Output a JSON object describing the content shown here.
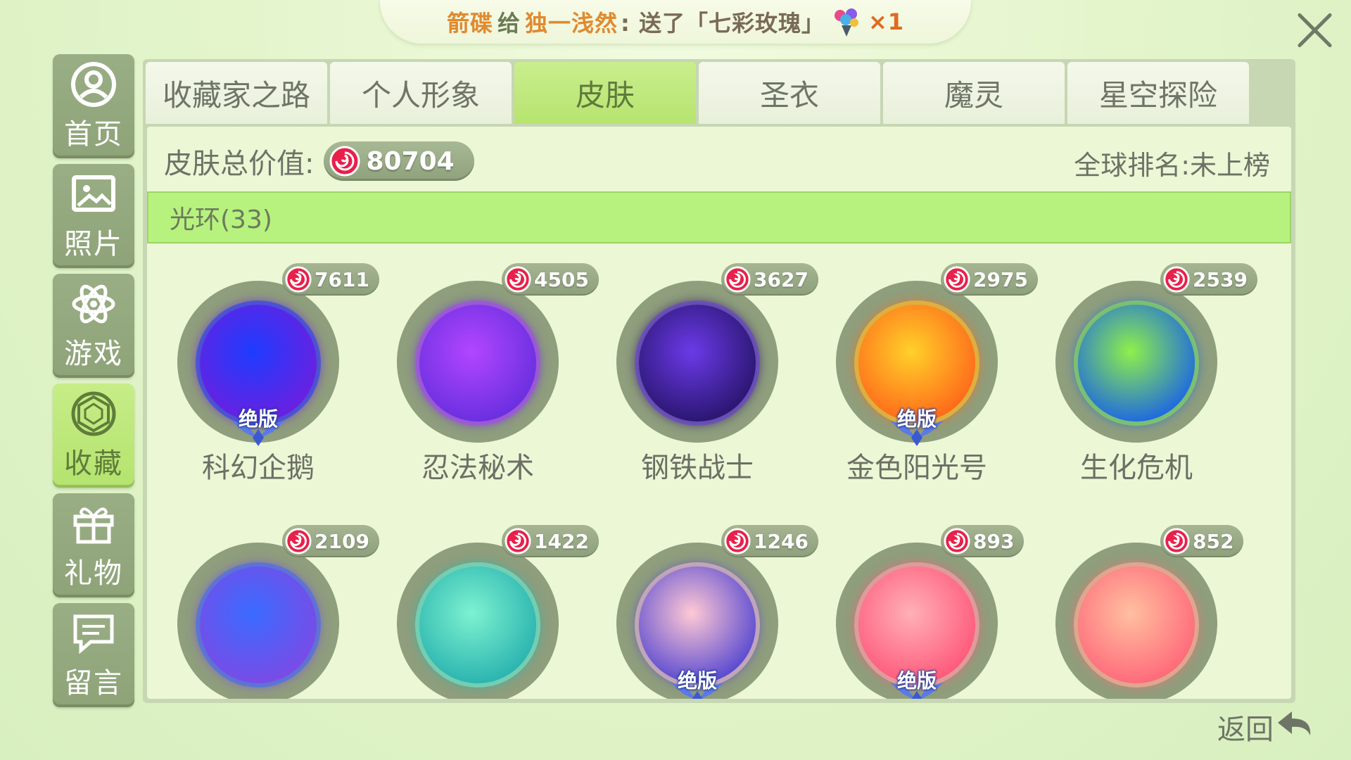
{
  "banner": {
    "sender": "箭碟",
    "gift_word": "给",
    "receiver": "独一浅然",
    "message": ": 送了「七彩玫瑰」",
    "count": "×1"
  },
  "sidebar": {
    "items": [
      {
        "label": "首页",
        "icon": "user-circle-icon",
        "active": false
      },
      {
        "label": "照片",
        "icon": "picture-icon",
        "active": false
      },
      {
        "label": "游戏",
        "icon": "atom-icon",
        "active": false
      },
      {
        "label": "收藏",
        "icon": "gem-icon",
        "active": true
      },
      {
        "label": "礼物",
        "icon": "gift-icon",
        "active": false
      },
      {
        "label": "留言",
        "icon": "message-icon",
        "active": false
      }
    ]
  },
  "tabs": [
    {
      "label": "收藏家之路",
      "active": false
    },
    {
      "label": "个人形象",
      "active": false
    },
    {
      "label": "皮肤",
      "active": true
    },
    {
      "label": "圣衣",
      "active": false
    },
    {
      "label": "魔灵",
      "active": false
    },
    {
      "label": "星空探险",
      "active": false
    }
  ],
  "summary": {
    "total_label": "皮肤总价值:",
    "total_value": "80704",
    "rank_text": "全球排名:未上榜"
  },
  "section": {
    "title": "光环(33)"
  },
  "skins": [
    {
      "name": "科幻企鹅",
      "price": "7611",
      "limited": true,
      "badge": "绝版",
      "color_a": "#1e3cff",
      "color_b": "#6a20e0"
    },
    {
      "name": "忍法秘术",
      "price": "4505",
      "limited": false,
      "badge": "",
      "color_a": "#b246ff",
      "color_b": "#6a2fe0"
    },
    {
      "name": "钢铁战士",
      "price": "3627",
      "limited": false,
      "badge": "",
      "color_a": "#6b3ae8",
      "color_b": "#2a1670"
    },
    {
      "name": "金色阳光号",
      "price": "2975",
      "limited": true,
      "badge": "绝版",
      "color_a": "#ffd12a",
      "color_b": "#ff6a1a"
    },
    {
      "name": "生化危机",
      "price": "2539",
      "limited": false,
      "badge": "",
      "color_a": "#8ef04a",
      "color_b": "#1f6adf"
    },
    {
      "name": "",
      "price": "2109",
      "limited": false,
      "badge": "",
      "color_a": "#3a6bff",
      "color_b": "#7a4be6"
    },
    {
      "name": "",
      "price": "1422",
      "limited": false,
      "badge": "",
      "color_a": "#7df2d0",
      "color_b": "#2bb4b0"
    },
    {
      "name": "",
      "price": "1246",
      "limited": true,
      "badge": "绝版",
      "color_a": "#ffc9d4",
      "color_b": "#5a4ad0"
    },
    {
      "name": "",
      "price": "893",
      "limited": true,
      "badge": "绝版",
      "color_a": "#ffb0b8",
      "color_b": "#ff5a7a"
    },
    {
      "name": "",
      "price": "852",
      "limited": false,
      "badge": "",
      "color_a": "#ffc0a0",
      "color_b": "#ff6a7a"
    }
  ],
  "footer": {
    "back_label": "返回"
  },
  "colors": {
    "active_green": "#b7e46f",
    "panel_bg": "#ecf7d6",
    "candy_red": "#e8204a"
  }
}
